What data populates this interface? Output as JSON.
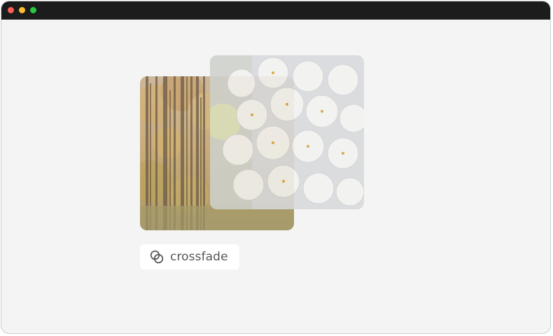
{
  "window": {
    "controls": [
      "close",
      "minimize",
      "zoom"
    ]
  },
  "gallery": {
    "back_image": "autumn-forest",
    "front_image": "white-lilac-flowers"
  },
  "chip": {
    "label": "crossfade",
    "icon": "crossfade-icon"
  },
  "colors": {
    "titlebar": "#1c1c1c",
    "background": "#f4f4f4",
    "chip_bg": "#ffffff",
    "text": "#555555"
  }
}
